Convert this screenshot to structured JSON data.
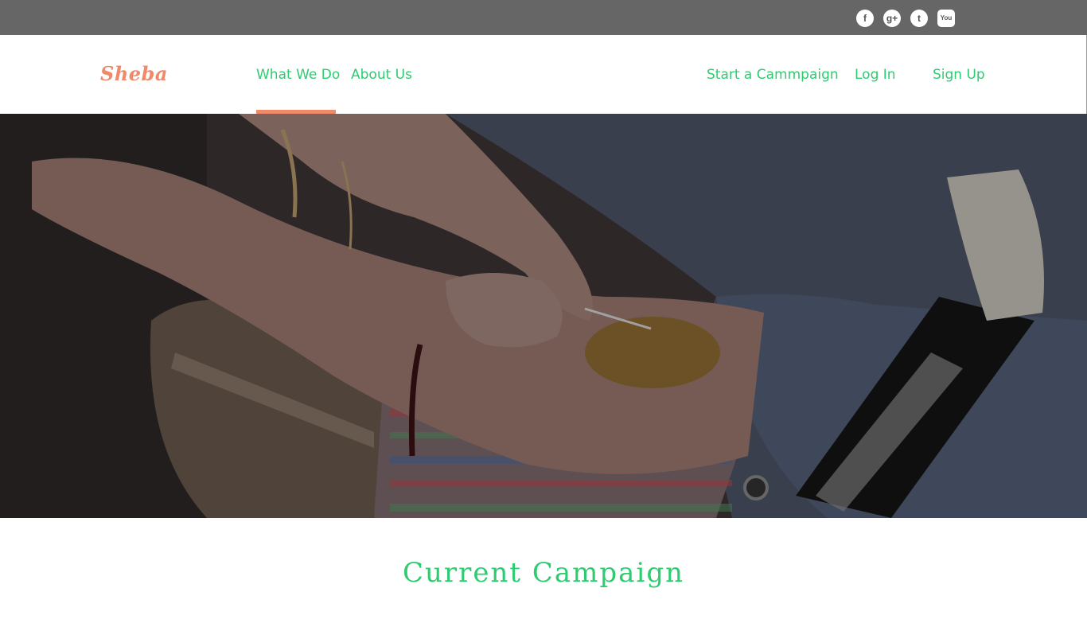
{
  "social": {
    "facebook": "f",
    "google_plus": "g+",
    "twitter": "t",
    "youtube": "You"
  },
  "brand": {
    "logo_text": "Sheba",
    "accent_color": "#f0896a",
    "link_color": "#2ecc71",
    "topbar_color": "#666666"
  },
  "nav": {
    "left": [
      "What We Do",
      "About Us"
    ],
    "right": [
      "Start a Cammpaign",
      "Log In",
      "Sign Up"
    ],
    "active": "What We Do"
  },
  "hero": {
    "image": "blood-donation-photo"
  },
  "main": {
    "section_title": "Current Campaign"
  }
}
